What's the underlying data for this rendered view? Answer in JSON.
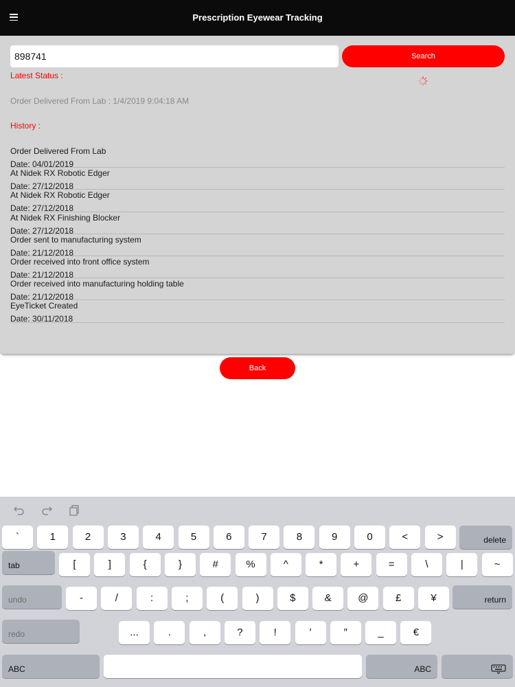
{
  "nav": {
    "title": "Prescription Eyewear Tracking",
    "menu_icon": "hamburger-menu-icon"
  },
  "search": {
    "value": "898741",
    "button_label": "Search"
  },
  "status": {
    "latest_label": "Latest Status :",
    "latest_value": "Order Delivered From Lab : 1/4/2019 9:04:18 AM",
    "history_label": "History :"
  },
  "history": [
    {
      "event": "Order Delivered From Lab",
      "date": "Date: 04/01/2019"
    },
    {
      "event": "At Nidek RX Robotic Edger",
      "date": "Date: 27/12/2018"
    },
    {
      "event": "At Nidek RX Robotic Edger",
      "date": "Date: 27/12/2018"
    },
    {
      "event": "At Nidek RX Finishing Blocker",
      "date": "Date: 27/12/2018"
    },
    {
      "event": "Order sent to manufacturing system",
      "date": "Date: 21/12/2018"
    },
    {
      "event": "Order received into front office system",
      "date": "Date: 21/12/2018"
    },
    {
      "event": "Order received into manufacturing holding table",
      "date": "Date: 21/12/2018"
    },
    {
      "event": "EyeTicket Created",
      "date": "Date: 30/11/2018"
    }
  ],
  "back_label": "Back",
  "keyboard": {
    "toolbar_icons": [
      "undo-arrow-icon",
      "redo-arrow-icon",
      "paste-icon"
    ],
    "row1": [
      "`",
      "1",
      "2",
      "3",
      "4",
      "5",
      "6",
      "7",
      "8",
      "9",
      "0",
      "<",
      ">"
    ],
    "delete": "delete",
    "tab": "tab",
    "row2": [
      "[",
      "]",
      "{",
      "}",
      "#",
      "%",
      "^",
      "*",
      "+",
      "=",
      "\\",
      "|",
      "~"
    ],
    "undo": "undo",
    "row3": [
      "-",
      "/",
      ":",
      ";",
      "(",
      ")",
      "$",
      "&",
      "@",
      "£",
      "¥"
    ],
    "return": "return",
    "redo": "redo",
    "row4": [
      "...",
      ".",
      ",",
      "?",
      "!",
      "′",
      "″",
      "_",
      "€"
    ],
    "abc_left": "ABC",
    "abc_right": "ABC"
  },
  "colors": {
    "accent": "#ff0000",
    "nav_bg": "#0b0b0b",
    "card_bg": "#d4d4d4",
    "keyboard_bg": "#d1d3d9"
  }
}
